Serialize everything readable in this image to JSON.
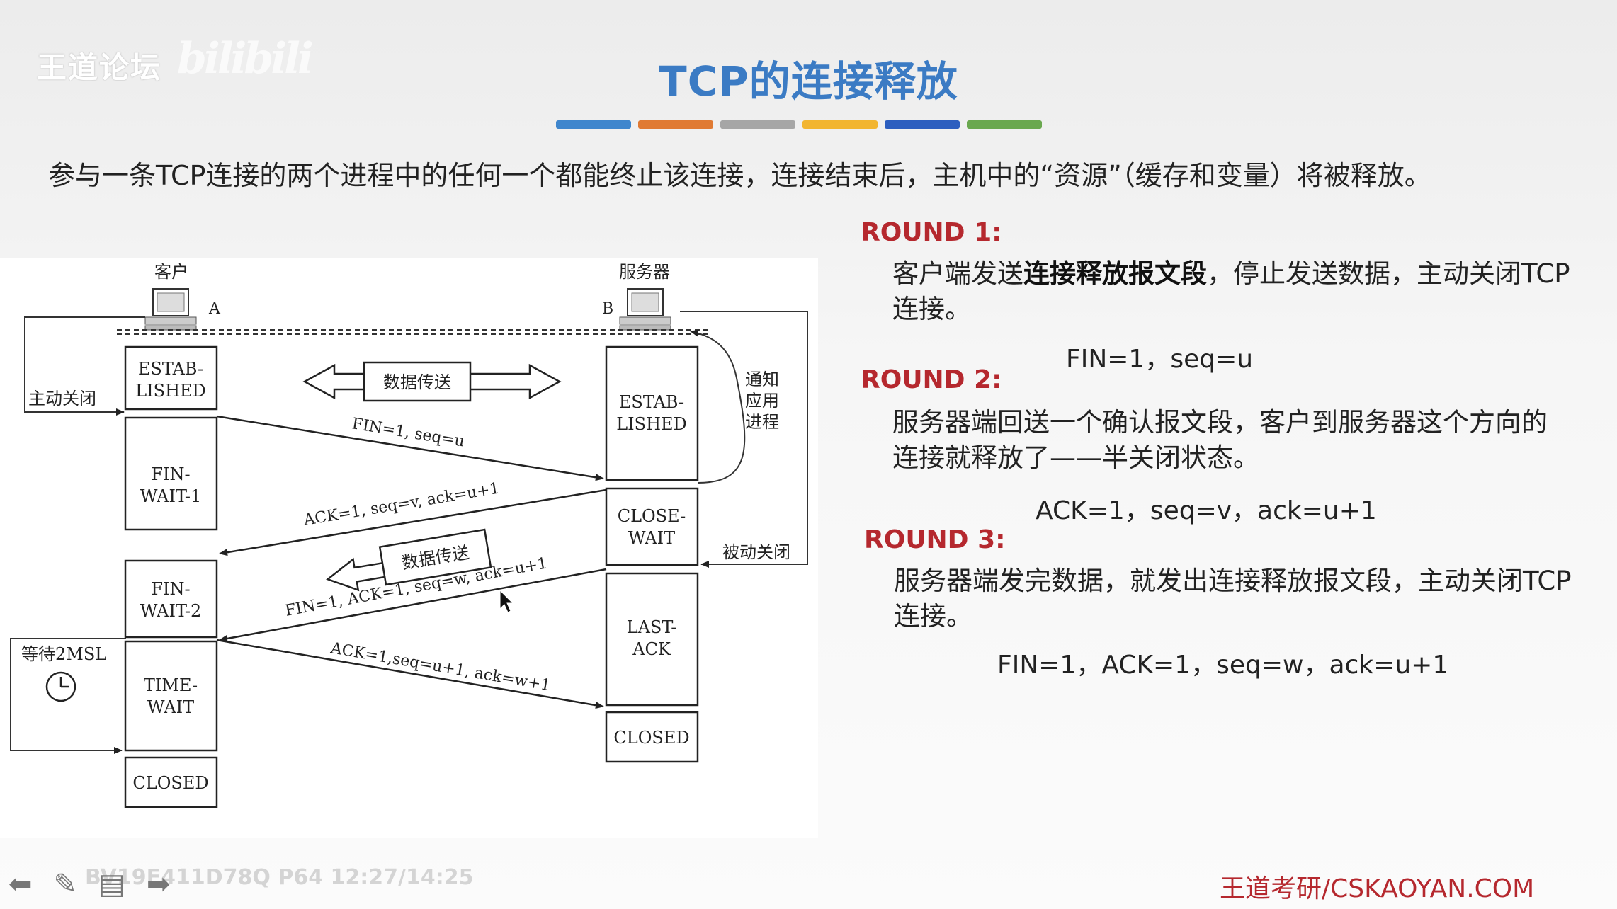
{
  "logo": {
    "text": "王道论坛",
    "watermark": "bilibili"
  },
  "title": "TCP的连接释放",
  "colorbar": [
    "#3f86cd",
    "#e07a33",
    "#a6a6a6",
    "#f2b530",
    "#2c5ebf",
    "#6aa84f"
  ],
  "intro": "参与一条TCP连接的两个进程中的任何一个都能终止该连接，连接结束后，主机中的“资源”（缓存和变量）将被释放。",
  "diagram": {
    "client_label": "客户",
    "server_label": "服务器",
    "host_a": "A",
    "host_b": "B",
    "active_close": "主动关闭",
    "passive_close": "被动关闭",
    "notify_app": [
      "通知",
      "应用",
      "进程"
    ],
    "wait_2msl": "等待2MSL",
    "data_transfer_top": "数据传送",
    "data_transfer_mid": "数据传送",
    "client_states": [
      [
        "ESTAB-",
        "LISHED"
      ],
      [
        "FIN-",
        "WAIT-1"
      ],
      [
        "FIN-",
        "WAIT-2"
      ],
      [
        "TIME-",
        "WAIT"
      ],
      [
        "CLOSED"
      ]
    ],
    "server_states": [
      [
        "ESTAB-",
        "LISHED"
      ],
      [
        "CLOSE-",
        "WAIT"
      ],
      [
        "LAST-",
        "ACK"
      ],
      [
        "CLOSED"
      ]
    ],
    "msg1": "FIN=1, seq=u",
    "msg2": "ACK=1, seq=v, ack=u+1",
    "msg3": "FIN=1, ACK=1, seq=w, ack=u+1",
    "msg4": "ACK=1,seq=u+1, ack=w+1"
  },
  "rounds": [
    {
      "title": "ROUND 1:",
      "text_pre": "客户端发送",
      "text_bold": "连接释放报文段",
      "text_post": "，停止发送数据，主动关闭TCP连接。",
      "formula": "FIN=1，seq=u"
    },
    {
      "title": "ROUND 2:",
      "text": "服务器端回送一个确认报文段，客户到服务器这个方向的连接就释放了——半关闭状态。",
      "formula": "ACK=1，seq=v，ack=u+1"
    },
    {
      "title": "ROUND 3:",
      "text": "服务器端发完数据，就发出连接释放报文段，主动关闭TCP连接。",
      "formula": "FIN=1，ACK=1，seq=w，ack=u+1"
    }
  ],
  "footer": {
    "url": "王道考研/CSKAOYAN.COM",
    "watermark": "BV19E411D78Q P64 12:27/14:25"
  },
  "nav_icons": [
    "arrow-left-icon",
    "pen-icon",
    "menu-icon",
    "arrow-right-icon"
  ]
}
